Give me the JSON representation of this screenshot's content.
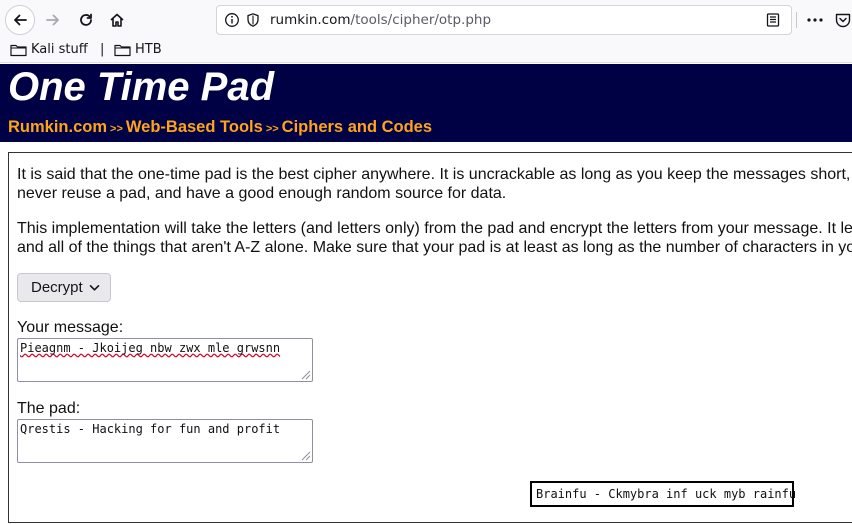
{
  "browser": {
    "url_host": "rumkin.com",
    "url_path": "/tools/cipher/otp.php",
    "bookmarks": [
      {
        "label": "Kali stuff"
      },
      {
        "label": "HTB"
      }
    ],
    "bookmark_separator": "|"
  },
  "header": {
    "title": "One Time Pad",
    "breadcrumbs": [
      "Rumkin.com",
      "Web-Based Tools",
      "Ciphers and Codes"
    ],
    "crumb_separator": ">>",
    "background": "#000044",
    "crumb_color": "#ffa31a"
  },
  "intro": {
    "p1_line1": "It is said that the one-time pad is the best cipher anywhere. It is uncrackable as long as you keep the messages short, u",
    "p1_line2": "never reuse a pad, and have a good enough random source for data.",
    "p2_line1": "This implementation will take the letters (and letters only) from the pad and encrypt the letters from your message. It leav",
    "p2_line2": "and all of the things that aren't A-Z alone. Make sure that your pad is at least as long as the number of characters in you"
  },
  "form": {
    "mode_selected": "Decrypt",
    "message_label": "Your message:",
    "message_value": "Pieagnm - Jkoijeg nbw zwx mle grwsnn",
    "pad_label": "The pad:",
    "pad_value": "Qrestis - Hacking for fun and profit",
    "result": "Brainfu - Ckmybra inf uck myb rainfu"
  }
}
